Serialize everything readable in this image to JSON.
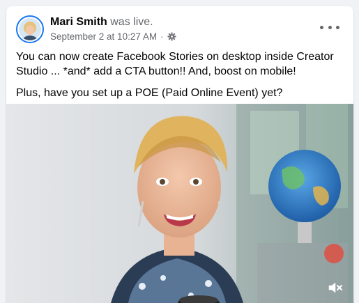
{
  "post": {
    "author_name": "Mari Smith",
    "author_status": "was live.",
    "timestamp": "September 2 at 10:27 AM",
    "meta_separator": "·",
    "audience_icon": "gear-icon",
    "text_lines": [
      "You can now create Facebook Stories on desktop inside Creator Studio ... *and* add a CTA button!! And, boost on mobile!",
      "Plus, have you set up a POE (Paid Online Event) yet?"
    ]
  },
  "video": {
    "mute_icon": "volume-muted-icon",
    "alt": "video"
  },
  "colors": {
    "background": "#f0f2f5",
    "card": "#ffffff",
    "primary_text": "#050505",
    "secondary_text": "#65676b",
    "avatar_ring": "#1877f2"
  }
}
